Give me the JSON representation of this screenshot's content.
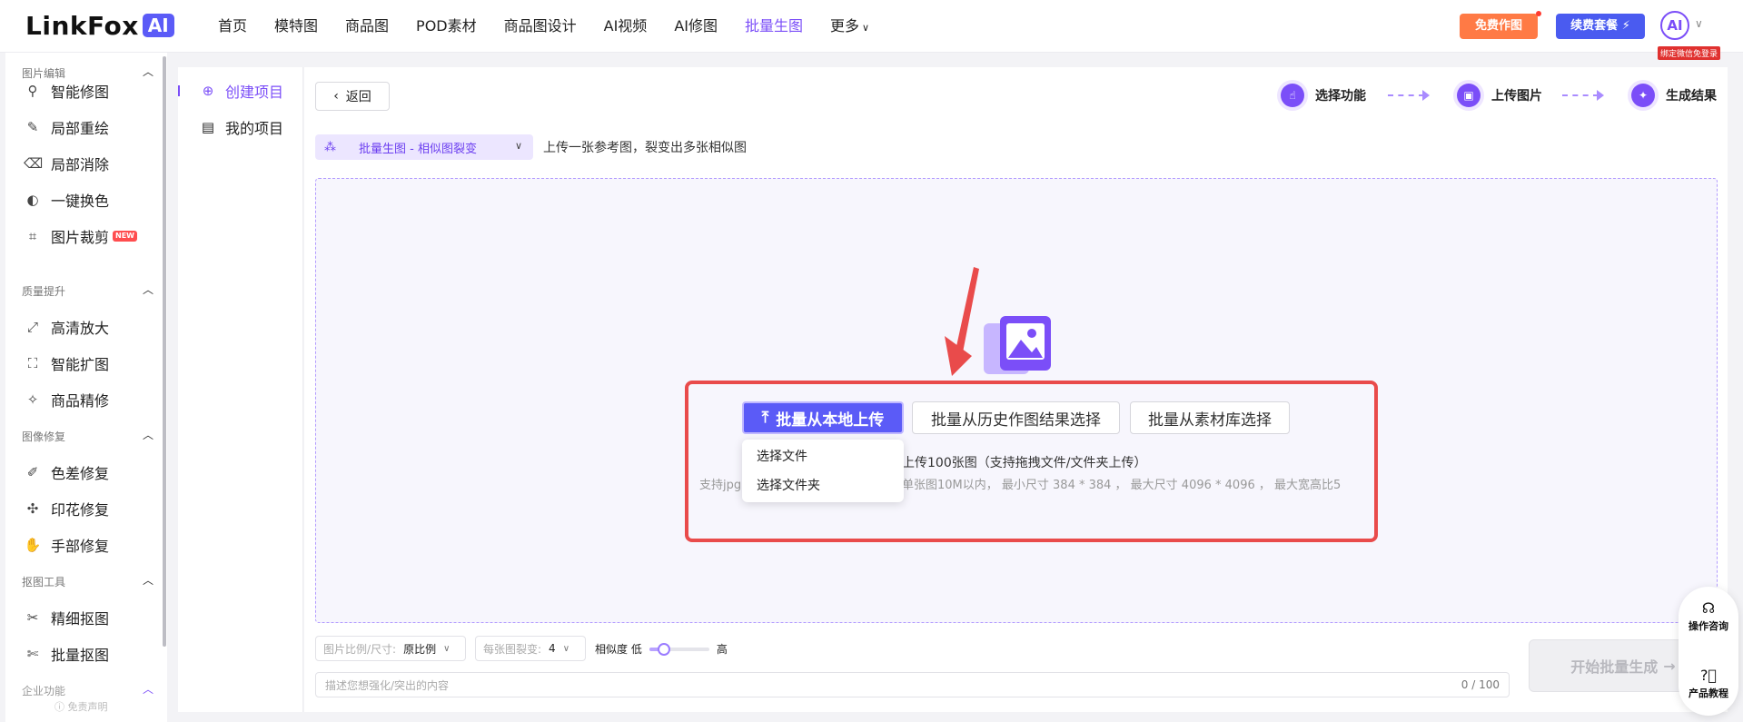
{
  "header": {
    "logo_text": "LinkFox",
    "logo_badge": "AI",
    "nav": [
      {
        "label": "首页"
      },
      {
        "label": "模特图"
      },
      {
        "label": "商品图"
      },
      {
        "label": "POD素材"
      },
      {
        "label": "商品图设计"
      },
      {
        "label": "AI视频"
      },
      {
        "label": "AI修图"
      },
      {
        "label": "批量生图",
        "active": true
      },
      {
        "label": "更多"
      }
    ],
    "free_btn": "免费作图",
    "renew_btn": "续费套餐",
    "renew_icon": "⚡",
    "avatar_text": "AI",
    "bind_badge": "绑定微信免登录"
  },
  "sidebar": {
    "sections": [
      {
        "title": "图片编辑",
        "items": [
          {
            "label": "智能修图",
            "icon": "magic-wand-icon"
          },
          {
            "label": "局部重绘",
            "icon": "brush-icon"
          },
          {
            "label": "局部消除",
            "icon": "eraser-icon"
          },
          {
            "label": "一键换色",
            "icon": "color-swap-icon"
          },
          {
            "label": "图片裁剪",
            "icon": "crop-icon",
            "badge": "NEW"
          }
        ]
      },
      {
        "title": "质量提升",
        "items": [
          {
            "label": "高清放大",
            "icon": "upscale-icon"
          },
          {
            "label": "智能扩图",
            "icon": "expand-icon"
          },
          {
            "label": "商品精修",
            "icon": "retouch-icon"
          }
        ]
      },
      {
        "title": "图像修复",
        "items": [
          {
            "label": "色差修复",
            "icon": "color-fix-icon"
          },
          {
            "label": "印花修复",
            "icon": "print-fix-icon"
          },
          {
            "label": "手部修复",
            "icon": "hand-icon"
          }
        ]
      },
      {
        "title": "抠图工具",
        "items": [
          {
            "label": "精细抠图",
            "icon": "cutout-icon"
          },
          {
            "label": "批量抠图",
            "icon": "batch-cutout-icon"
          }
        ]
      },
      {
        "title": "企业功能",
        "items": []
      }
    ],
    "disclaimer": "免责声明"
  },
  "projects": {
    "create": "创建项目",
    "mine": "我的项目"
  },
  "main": {
    "back": "返回",
    "steps": [
      {
        "label": "选择功能"
      },
      {
        "label": "上传图片"
      },
      {
        "label": "生成结果"
      }
    ],
    "mode": "批量生图 - 相似图裂变",
    "mode_desc": "上传一张参考图，裂变出多张相似图",
    "upload_local": "批量从本地上传",
    "upload_history": "批量从历史作图结果选择",
    "upload_library": "批量从素材库选择",
    "hint_main": "上传100张图（支持拖拽文件/文件夹上传）",
    "hint_formats_prefix": "支持jpg",
    "hint_limits": "单张图10M以内， 最小尺寸 384 * 384 ， 最大尺寸 4096 * 4096 ， 最大宽高比5",
    "dropdown": [
      "选择文件",
      "选择文件夹"
    ]
  },
  "controls": {
    "ratio_label": "图片比例/尺寸:",
    "ratio_value": "原比例",
    "count_label": "每张图裂变:",
    "count_value": "4",
    "similarity_label": "相似度",
    "similarity_low": "低",
    "similarity_high": "高",
    "similarity_level": 0.25,
    "prompt_placeholder": "描述您想强化/突出的内容",
    "prompt_count": "0 / 100",
    "start": "开始批量生成"
  },
  "help": {
    "consult": "操作咨询",
    "tutorial": "产品教程"
  },
  "colors": {
    "accent": "#7b4ef8",
    "primary_btn": "#5b5bf7",
    "highlight_box": "#e94b4b"
  }
}
